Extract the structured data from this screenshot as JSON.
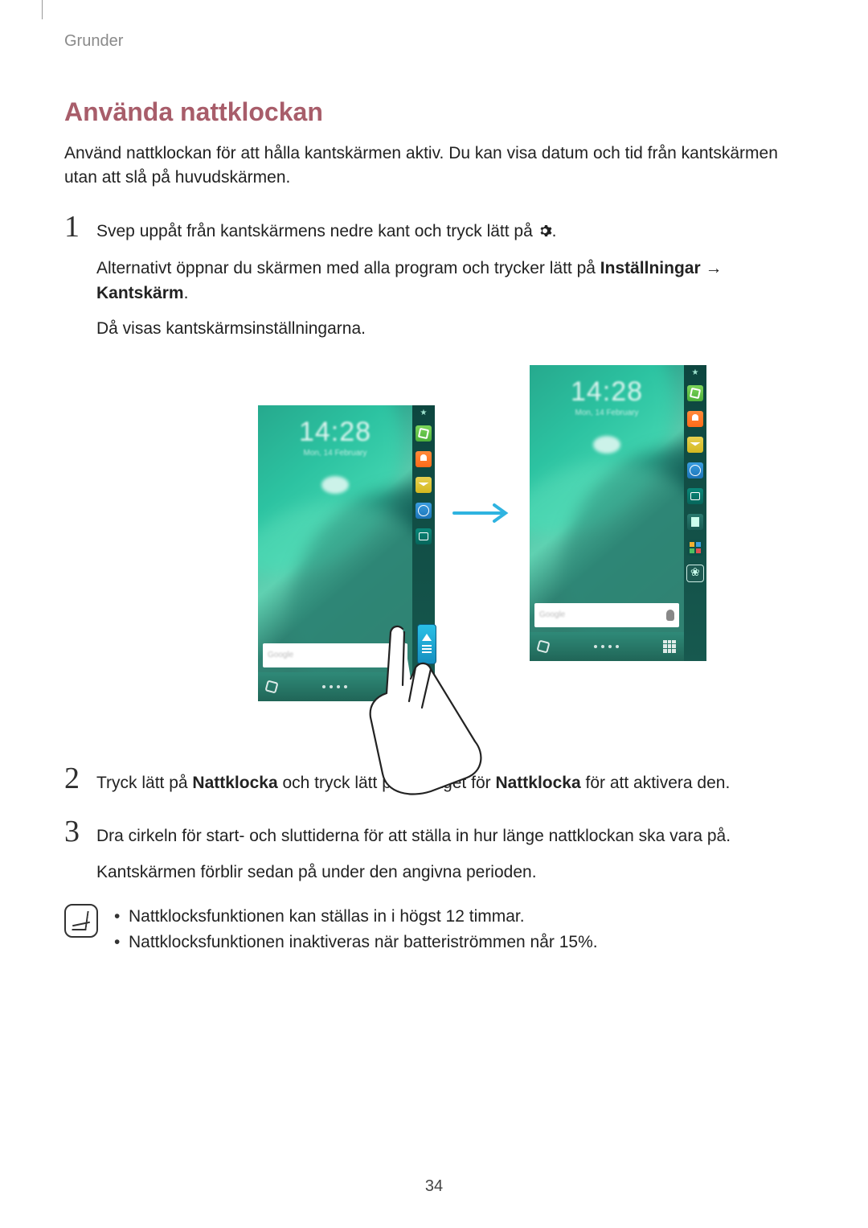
{
  "chapter": "Grunder",
  "section_title": "Använda nattklockan",
  "intro": "Använd nattklockan för att hålla kantskärmen aktiv. Du kan visa datum och tid från kantskärmen utan att slå på huvudskärmen.",
  "steps": {
    "s1_a": "Svep uppåt från kantskärmens nedre kant och tryck lätt på ",
    "s1_b_pre": "Alternativt öppnar du skärmen med alla program och trycker lätt på ",
    "s1_b_bold1": "Inställningar",
    "s1_b_arrow": " → ",
    "s1_b_bold2": "Kantskärm",
    "s1_c": "Då visas kantskärmsinställningarna.",
    "s2_pre": "Tryck lätt på ",
    "s2_bold1": "Nattklocka",
    "s2_mid": " och tryck lätt på reglaget för ",
    "s2_bold2": "Nattklocka",
    "s2_end": " för att aktivera den.",
    "s3_a": "Dra cirkeln för start- och sluttiderna för att ställa in hur länge nattklockan ska vara på.",
    "s3_b": "Kantskärmen förblir sedan på under den angivna perioden."
  },
  "numbers": {
    "n1": "1",
    "n2": "2",
    "n3": "3"
  },
  "notes": {
    "n1": "Nattklocksfunktionen kan ställas in i högst 12 timmar.",
    "n2": "Nattklocksfunktionen inaktiveras när batteriströmmen når 15%."
  },
  "figure": {
    "clock_time": "14:28",
    "clock_sub": "Mon, 14 February",
    "search_placeholder": "Google"
  },
  "page_number": "34"
}
